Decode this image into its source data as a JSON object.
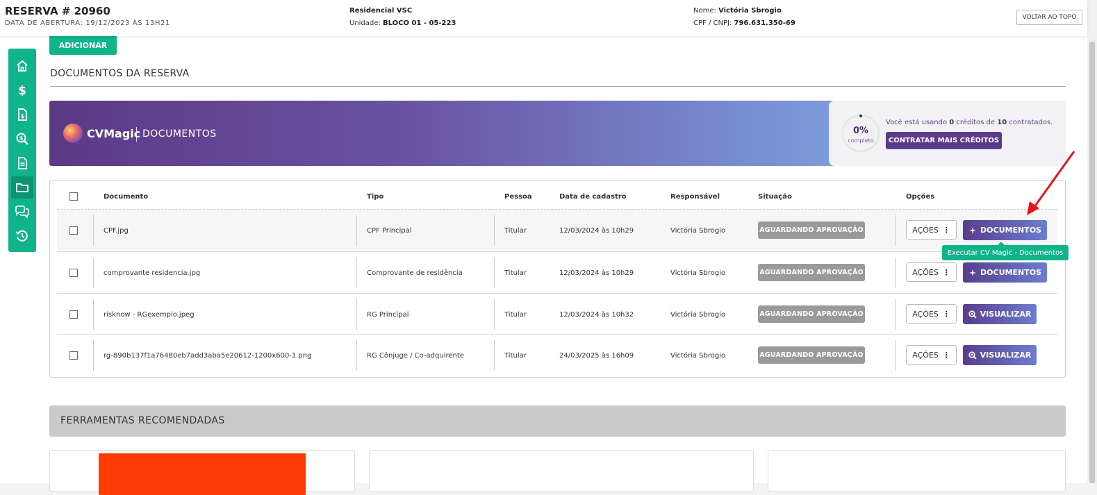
{
  "header": {
    "reserva_title": "RESERVA # 20960",
    "data_abertura": "DATA DE ABERTURA: 19/12/2023 ÀS 13H21",
    "empreendimento": "Residencial VSC",
    "unidade_label": "Unidade:",
    "unidade_value": "BLOCO 01 - 05-223",
    "nome_label": "Nome:",
    "nome_value": "Victória Sbrogio",
    "cpf_label": "CPF / CNPJ:",
    "cpf_value": "796.631.350-69",
    "voltar_label": "VOLTAR AO TOPO"
  },
  "sidebar": {
    "items": [
      {
        "icon": "home-icon",
        "active": false
      },
      {
        "icon": "dollar-icon",
        "active": false
      },
      {
        "icon": "invoice-icon",
        "active": false
      },
      {
        "icon": "search-money-icon",
        "active": false
      },
      {
        "icon": "document-icon",
        "active": false
      },
      {
        "icon": "folder-icon",
        "active": true
      },
      {
        "icon": "chat-icon",
        "active": false
      },
      {
        "icon": "history-icon",
        "active": false
      }
    ]
  },
  "main": {
    "add_label": "ADICIONAR",
    "section_title": "DOCUMENTOS DA RESERVA",
    "banner": {
      "brand": "CVMagic",
      "subtitle": "DOCUMENTOS",
      "progress_pct": "0%",
      "progress_fraction": 0,
      "progress_label": "completo",
      "credits_pre": "Você está usando",
      "credits_used": "0",
      "credits_mid": "créditos de",
      "credits_total": "10",
      "credits_post": "contratados.",
      "buy_label": "CONTRATAR MAIS CRÉDITOS"
    },
    "table": {
      "headers": {
        "documento": "Documento",
        "tipo": "Tipo",
        "pessoa": "Pessoa",
        "data": "Data de cadastro",
        "responsavel": "Responsável",
        "situacao": "Situação",
        "opcoes": "Opções"
      },
      "rows": [
        {
          "documento": "CPF.jpg",
          "tipo": "CPF Principal",
          "pessoa": "Titular",
          "data": "12/03/2024 às 10h29",
          "responsavel": "Victória Sbrogio",
          "situacao": "AGUARDANDO APROVAÇÃO",
          "acoes": "AÇÕES",
          "action": "DOCUMENTOS"
        },
        {
          "documento": "comprovante residencia.jpg",
          "tipo": "Comprovante de residência",
          "pessoa": "Titular",
          "data": "12/03/2024 às 10h29",
          "responsavel": "Victória Sbrogio",
          "situacao": "AGUARDANDO APROVAÇÃO",
          "acoes": "AÇÕES",
          "action": "DOCUMENTOS"
        },
        {
          "documento": "risknow - RGexemplo.jpeg",
          "tipo": "RG Principal",
          "pessoa": "Titular",
          "data": "12/03/2024 às 10h32",
          "responsavel": "Victória Sbrogio",
          "situacao": "AGUARDANDO APROVAÇÃO",
          "acoes": "AÇÕES",
          "action": "VISUALIZAR"
        },
        {
          "documento": "rg-890b137f1a76480eb7add3aba5e20612-1200x600-1.png",
          "tipo": "RG Cônjuge / Co-adquirente",
          "pessoa": "Titular",
          "data": "24/03/2025 às 16h09",
          "responsavel": "Victória Sbrogio",
          "situacao": "AGUARDANDO APROVAÇÃO",
          "acoes": "AÇÕES",
          "action": "VISUALIZAR"
        }
      ]
    },
    "tooltip": "Executar CV Magic - Documentos",
    "tools_title": "FERRAMENTAS RECOMENDADAS"
  },
  "colors": {
    "brand_green": "#10b48a",
    "purple": "#5a3d8c",
    "badge_gray": "#9a9a9a",
    "arrow_red": "#e8141c"
  }
}
